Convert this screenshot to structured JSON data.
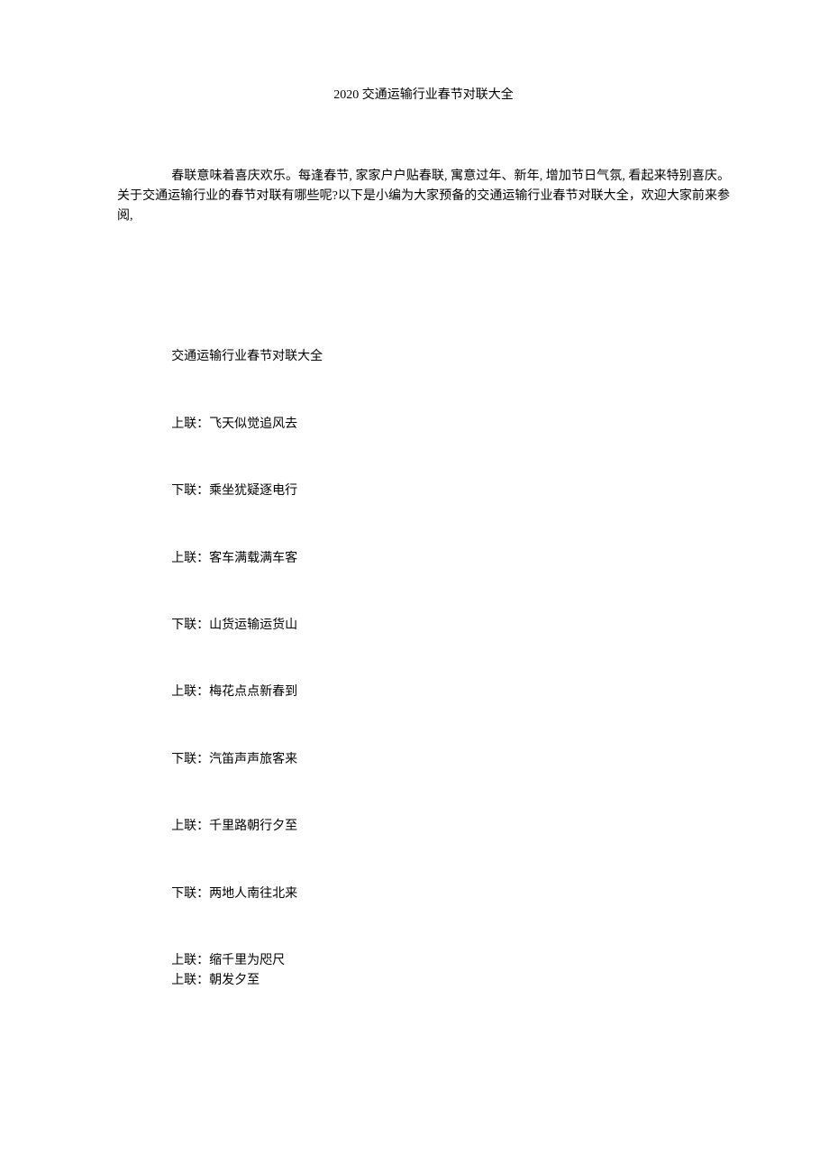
{
  "title": "2020 交通运输行业春节对联大全",
  "intro": "春联意味着喜庆欢乐。每逢春节, 家家户户贴春联, 寓意过年、新年, 增加节日气氛, 看起来特别喜庆。关于交通运输行业的春节对联有哪些呢?以下是小编为大家预备的交通运输行业春节对联大全，欢迎大家前来参阅,",
  "section_header": "交通运输行业春节对联大全",
  "couplets": {
    "c1_upper": "上联：飞天似觉追风去",
    "c1_lower": "下联：乘坐犹疑逐电行",
    "c2_upper": "上联：客车满载满车客",
    "c2_lower": "下联：山货运输运货山",
    "c3_upper": "上联：梅花点点新春到",
    "c3_lower": "下联：汽笛声声旅客来",
    "c4_upper": "上联：千里路朝行夕至",
    "c4_lower": "下联：两地人南往北来",
    "c5_upper": "上联：缩千里为咫尺",
    "c6_upper": "上联：朝发夕至"
  }
}
